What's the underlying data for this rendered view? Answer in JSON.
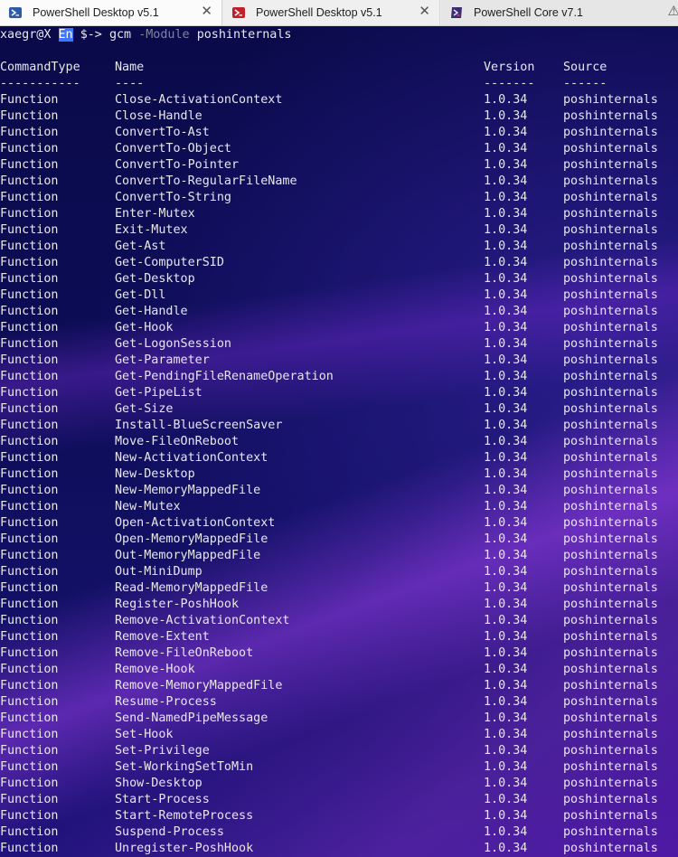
{
  "tabs": [
    {
      "label": "PowerShell Desktop v5.1",
      "icon": "powershell-blue-icon",
      "color": "#2e5aa8",
      "close": "✕"
    },
    {
      "label": "PowerShell Desktop v5.1",
      "icon": "powershell-red-icon",
      "color": "#c4202b",
      "close": "✕"
    },
    {
      "label": "PowerShell Core v7.1",
      "icon": "powershell-core-icon",
      "color": "#5a2d82",
      "close": "⚠"
    }
  ],
  "terminal": {
    "prompt_user": "xaegr@X",
    "prompt_lang": "En",
    "prompt_symbol": "$->",
    "command": "gcm",
    "param": "-Module",
    "arg": "poshinternals",
    "headers": [
      "CommandType",
      "Name",
      "Version",
      "Source"
    ],
    "separators": [
      "-----------",
      "----",
      "-------",
      "------"
    ],
    "rows": [
      [
        "Function",
        "Close-ActivationContext",
        "1.0.34",
        "poshinternals"
      ],
      [
        "Function",
        "Close-Handle",
        "1.0.34",
        "poshinternals"
      ],
      [
        "Function",
        "ConvertTo-Ast",
        "1.0.34",
        "poshinternals"
      ],
      [
        "Function",
        "ConvertTo-Object",
        "1.0.34",
        "poshinternals"
      ],
      [
        "Function",
        "ConvertTo-Pointer",
        "1.0.34",
        "poshinternals"
      ],
      [
        "Function",
        "ConvertTo-RegularFileName",
        "1.0.34",
        "poshinternals"
      ],
      [
        "Function",
        "ConvertTo-String",
        "1.0.34",
        "poshinternals"
      ],
      [
        "Function",
        "Enter-Mutex",
        "1.0.34",
        "poshinternals"
      ],
      [
        "Function",
        "Exit-Mutex",
        "1.0.34",
        "poshinternals"
      ],
      [
        "Function",
        "Get-Ast",
        "1.0.34",
        "poshinternals"
      ],
      [
        "Function",
        "Get-ComputerSID",
        "1.0.34",
        "poshinternals"
      ],
      [
        "Function",
        "Get-Desktop",
        "1.0.34",
        "poshinternals"
      ],
      [
        "Function",
        "Get-Dll",
        "1.0.34",
        "poshinternals"
      ],
      [
        "Function",
        "Get-Handle",
        "1.0.34",
        "poshinternals"
      ],
      [
        "Function",
        "Get-Hook",
        "1.0.34",
        "poshinternals"
      ],
      [
        "Function",
        "Get-LogonSession",
        "1.0.34",
        "poshinternals"
      ],
      [
        "Function",
        "Get-Parameter",
        "1.0.34",
        "poshinternals"
      ],
      [
        "Function",
        "Get-PendingFileRenameOperation",
        "1.0.34",
        "poshinternals"
      ],
      [
        "Function",
        "Get-PipeList",
        "1.0.34",
        "poshinternals"
      ],
      [
        "Function",
        "Get-Size",
        "1.0.34",
        "poshinternals"
      ],
      [
        "Function",
        "Install-BlueScreenSaver",
        "1.0.34",
        "poshinternals"
      ],
      [
        "Function",
        "Move-FileOnReboot",
        "1.0.34",
        "poshinternals"
      ],
      [
        "Function",
        "New-ActivationContext",
        "1.0.34",
        "poshinternals"
      ],
      [
        "Function",
        "New-Desktop",
        "1.0.34",
        "poshinternals"
      ],
      [
        "Function",
        "New-MemoryMappedFile",
        "1.0.34",
        "poshinternals"
      ],
      [
        "Function",
        "New-Mutex",
        "1.0.34",
        "poshinternals"
      ],
      [
        "Function",
        "Open-ActivationContext",
        "1.0.34",
        "poshinternals"
      ],
      [
        "Function",
        "Open-MemoryMappedFile",
        "1.0.34",
        "poshinternals"
      ],
      [
        "Function",
        "Out-MemoryMappedFile",
        "1.0.34",
        "poshinternals"
      ],
      [
        "Function",
        "Out-MiniDump",
        "1.0.34",
        "poshinternals"
      ],
      [
        "Function",
        "Read-MemoryMappedFile",
        "1.0.34",
        "poshinternals"
      ],
      [
        "Function",
        "Register-PoshHook",
        "1.0.34",
        "poshinternals"
      ],
      [
        "Function",
        "Remove-ActivationContext",
        "1.0.34",
        "poshinternals"
      ],
      [
        "Function",
        "Remove-Extent",
        "1.0.34",
        "poshinternals"
      ],
      [
        "Function",
        "Remove-FileOnReboot",
        "1.0.34",
        "poshinternals"
      ],
      [
        "Function",
        "Remove-Hook",
        "1.0.34",
        "poshinternals"
      ],
      [
        "Function",
        "Remove-MemoryMappedFile",
        "1.0.34",
        "poshinternals"
      ],
      [
        "Function",
        "Resume-Process",
        "1.0.34",
        "poshinternals"
      ],
      [
        "Function",
        "Send-NamedPipeMessage",
        "1.0.34",
        "poshinternals"
      ],
      [
        "Function",
        "Set-Hook",
        "1.0.34",
        "poshinternals"
      ],
      [
        "Function",
        "Set-Privilege",
        "1.0.34",
        "poshinternals"
      ],
      [
        "Function",
        "Set-WorkingSetToMin",
        "1.0.34",
        "poshinternals"
      ],
      [
        "Function",
        "Show-Desktop",
        "1.0.34",
        "poshinternals"
      ],
      [
        "Function",
        "Start-Process",
        "1.0.34",
        "poshinternals"
      ],
      [
        "Function",
        "Start-RemoteProcess",
        "1.0.34",
        "poshinternals"
      ],
      [
        "Function",
        "Suspend-Process",
        "1.0.34",
        "poshinternals"
      ],
      [
        "Function",
        "Unregister-PoshHook",
        "1.0.34",
        "poshinternals"
      ]
    ]
  }
}
